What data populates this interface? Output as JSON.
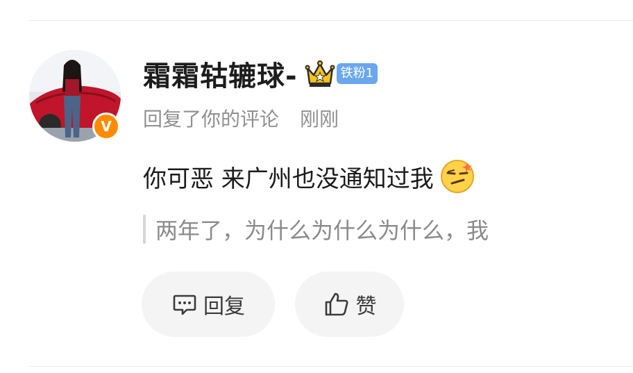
{
  "notification": {
    "user": {
      "name": "霜霜轱辘球-",
      "verified_badge": "V",
      "fan_badge": "铁粉1",
      "crown_icon": "crown-icon"
    },
    "action": "回复了你的评论",
    "time": "刚刚",
    "comment": "你可恶 来广州也没通知过我",
    "comment_emoji": "smirk-emoji",
    "quoted": "两年了，为什么为什么为什么，我",
    "buttons": {
      "reply": "回复",
      "like": "赞"
    }
  },
  "colors": {
    "verified": "#ff8a00",
    "fan_badge": "#6aa7ee",
    "button_bg": "#f4f4f4",
    "meta_text": "#8f8f8f"
  }
}
